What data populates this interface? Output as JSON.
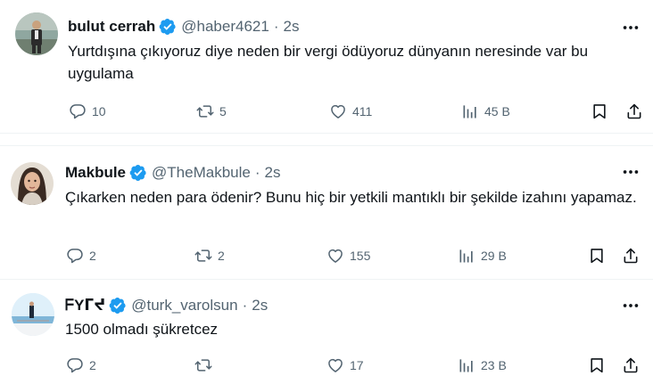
{
  "tweets": [
    {
      "name": "bulut cerrah",
      "handle": "@haber4621",
      "separator": "·",
      "time": "2s",
      "text": "Yurtdışına çıkıyoruz diye neden bir vergi ödüyoruz dünyanın neresinde var bu uygulama",
      "replies": "10",
      "retweets": "5",
      "likes": "411",
      "views": "45 B",
      "verified": true
    },
    {
      "name": "Makbule",
      "handle": "@TheMakbule",
      "separator": "·",
      "time": "2s",
      "text": "Çıkarken neden para ödenir? Bunu hiç bir yetkili mantıklı bir şekilde izahını yapamaz.",
      "replies": "2",
      "retweets": "2",
      "likes": "155",
      "views": "29 B",
      "verified": true
    },
    {
      "name": "ᖴYᒥᔪ",
      "handle": "@turk_varolsun",
      "separator": "·",
      "time": "2s",
      "text": "1500 olmadı şükretcez",
      "replies": "2",
      "retweets": "",
      "likes": "17",
      "views": "23 B",
      "verified": true
    }
  ],
  "colors": {
    "verified": "#1d9bf0",
    "secondary_text": "#536471",
    "primary_text": "#0f1419",
    "divider": "#eff3f4"
  },
  "icons": [
    "verified-badge-icon",
    "more-icon",
    "reply-icon",
    "retweet-icon",
    "like-icon",
    "views-icon",
    "bookmark-icon",
    "share-icon"
  ]
}
